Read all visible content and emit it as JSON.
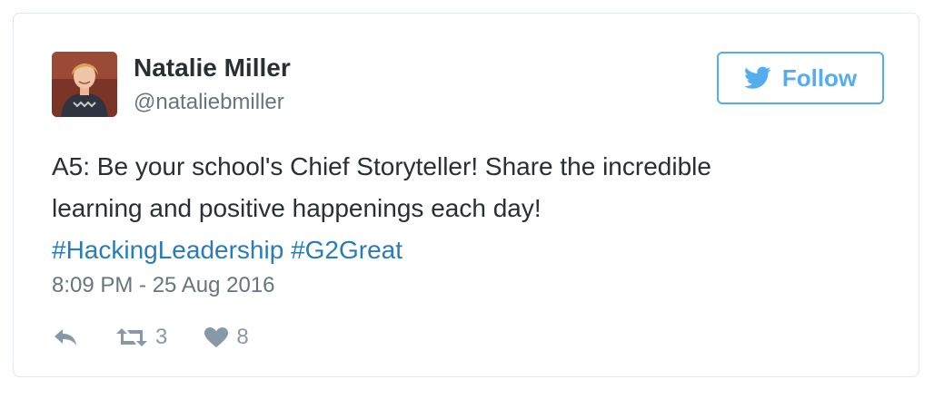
{
  "author": {
    "name": "Natalie Miller",
    "handle": "@nataliebmiller"
  },
  "follow_button": {
    "label": "Follow",
    "icon": "twitter-bird-icon"
  },
  "tweet": {
    "text_line1": "A5: Be your school's Chief Storyteller! Share the incredible",
    "text_line2": "learning and positive happenings each day!",
    "hashtags": [
      "#HackingLeadership",
      "#G2Great"
    ]
  },
  "timestamp": "8:09 PM - 25 Aug 2016",
  "actions": {
    "reply": {
      "icon": "reply-icon"
    },
    "retweet": {
      "icon": "retweet-icon",
      "count": "3"
    },
    "like": {
      "icon": "heart-icon",
      "count": "8"
    }
  },
  "colors": {
    "accent": "#55acee",
    "link": "#2b7bb9",
    "text": "#292f33",
    "muted": "#66757f",
    "icon": "#8899a6",
    "border": "#e1e8ed"
  }
}
